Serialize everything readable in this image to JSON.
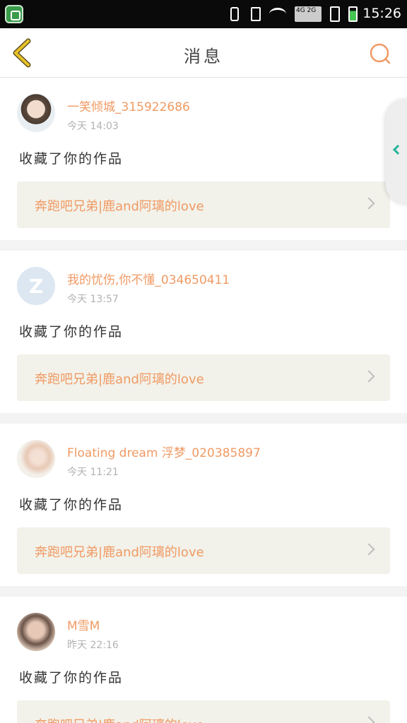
{
  "status_bar": {
    "time": "15:26",
    "signal_label": "4G 2G",
    "icons": [
      "app-shield-icon",
      "vibrate-icon",
      "mute-icon",
      "wifi-icon",
      "signal-icon",
      "sim-icon",
      "battery-icon"
    ]
  },
  "header": {
    "title": "消息",
    "back_icon": "chevron-left-icon",
    "search_icon": "search-icon"
  },
  "colors": {
    "accent": "#f09a64",
    "back_icon": "#e7c12a",
    "side_chevron": "#26b59c"
  },
  "messages": [
    {
      "user": "一笑倾城_315922686",
      "time": "今天  14:03",
      "action": "收藏了你的作品",
      "work": "奔跑吧兄弟|鹿and阿璃的love"
    },
    {
      "user": "我的忧伤,你不懂_034650411",
      "time": "今天  13:57",
      "action": "收藏了你的作品",
      "work": "奔跑吧兄弟|鹿and阿璃的love"
    },
    {
      "user": "Floating dream 浮梦_020385897",
      "time": "今天  11:21",
      "action": "收藏了你的作品",
      "work": "奔跑吧兄弟|鹿and阿璃的love"
    },
    {
      "user": "M雪M",
      "time": "昨天  22:16",
      "action": "收藏了你的作品",
      "work": "奔跑吧兄弟|鹿and阿璃的love"
    }
  ]
}
